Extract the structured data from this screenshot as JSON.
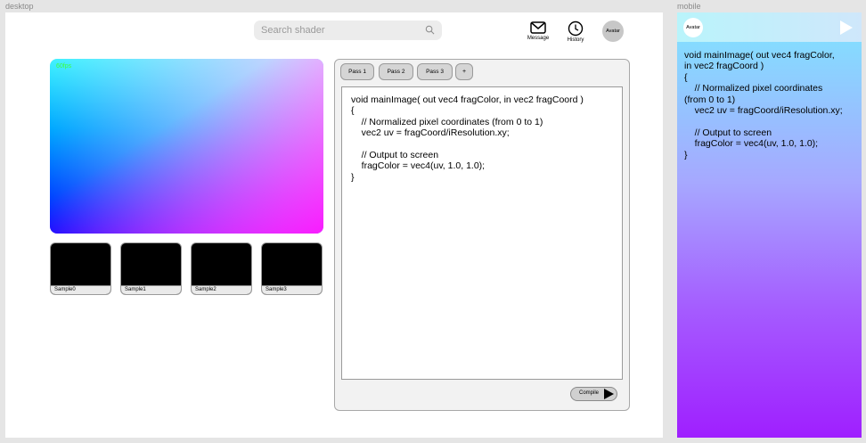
{
  "frames": {
    "desktop_label": "desktop",
    "mobile_label": "mobile"
  },
  "search": {
    "placeholder": "Search shader"
  },
  "header": {
    "message_label": "Message",
    "history_label": "History",
    "avatar_label": "Avatar"
  },
  "preview": {
    "fps_label": "60fps"
  },
  "samples": [
    {
      "label": "Sample0"
    },
    {
      "label": "Sample1"
    },
    {
      "label": "Sample2"
    },
    {
      "label": "Sample3"
    }
  ],
  "editor": {
    "tabs": [
      {
        "label": "Pass 1"
      },
      {
        "label": "Pass 2"
      },
      {
        "label": "Pass 3"
      }
    ],
    "add_tab_label": "+",
    "code": "void mainImage( out vec4 fragColor, in vec2 fragCoord )\n{\n    // Normalized pixel coordinates (from 0 to 1)\n    vec2 uv = fragCoord/iResolution.xy;\n\n    // Output to screen\n    fragColor = vec4(uv, 1.0, 1.0);\n}",
    "compile_label": "Compile"
  },
  "mobile": {
    "avatar_label": "Avatar",
    "code": "void mainImage( out vec4 fragColor,\nin vec2 fragCoord )\n{\n    // Normalized pixel coordinates\n(from 0 to 1)\n    vec2 uv = fragCoord/iResolution.xy;\n\n    // Output to screen\n    fragColor = vec4(uv, 1.0, 1.0);\n}"
  },
  "icons": {
    "search": "search-icon",
    "message": "envelope-icon",
    "history": "clock-icon",
    "compile": "play-icon",
    "mobile_run": "play-icon"
  }
}
